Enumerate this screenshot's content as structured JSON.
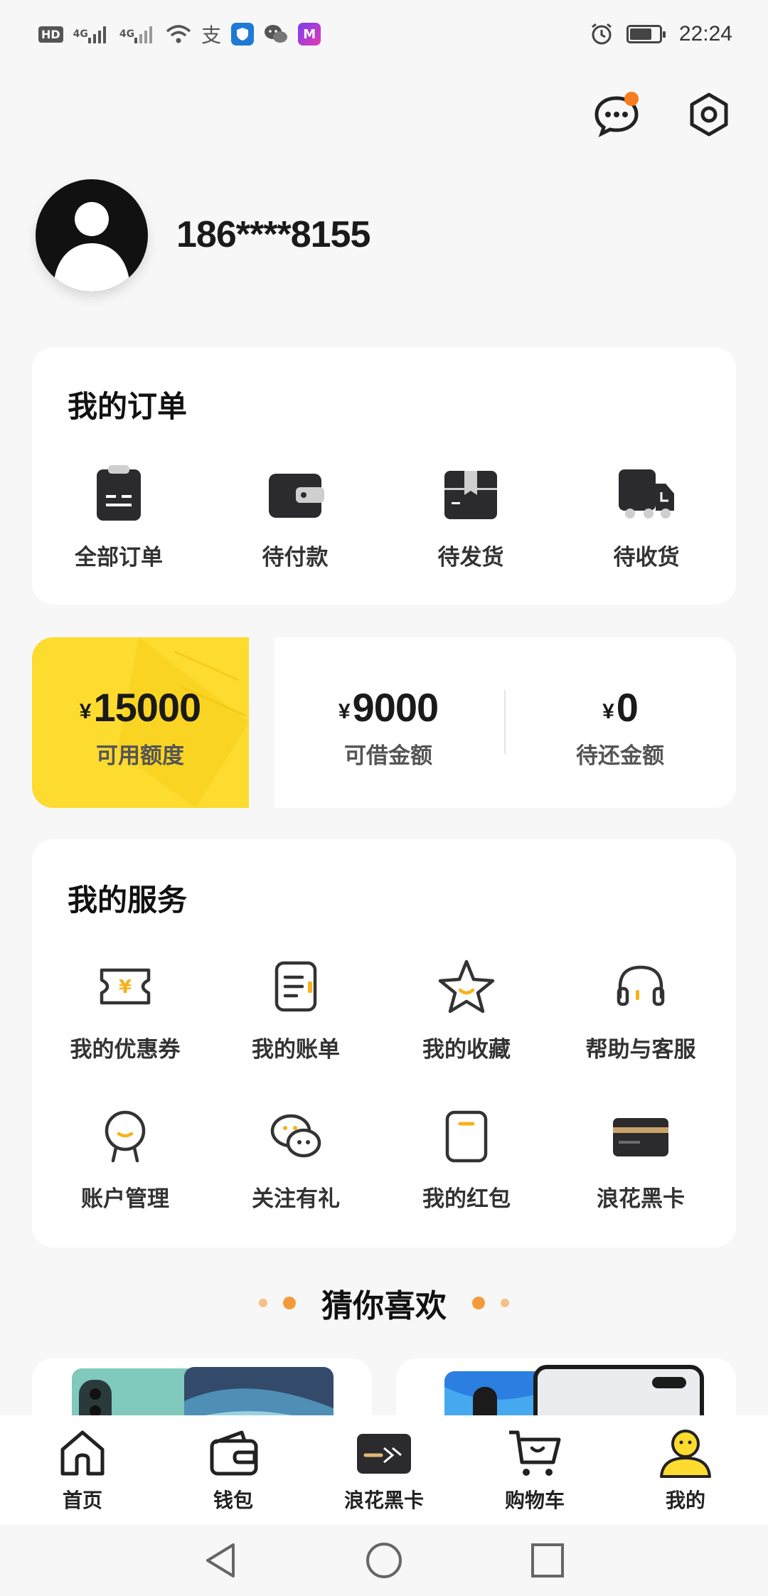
{
  "status_bar": {
    "hd_label": "HD",
    "net1": "4G",
    "net2": "4G",
    "alipay_glyph": "支",
    "time": "22:24"
  },
  "profile": {
    "phone": "186****8155"
  },
  "orders": {
    "title": "我的订单",
    "items": [
      {
        "label": "全部订单",
        "icon": "clipboard-icon"
      },
      {
        "label": "待付款",
        "icon": "wallet-icon"
      },
      {
        "label": "待发货",
        "icon": "box-icon"
      },
      {
        "label": "待收货",
        "icon": "truck-icon"
      }
    ]
  },
  "credit": {
    "currency": "¥",
    "available": {
      "value": "15000",
      "label": "可用额度"
    },
    "borrowable": {
      "value": "9000",
      "label": "可借金额"
    },
    "repay": {
      "value": "0",
      "label": "待还金额"
    }
  },
  "services": {
    "title": "我的服务",
    "items": [
      {
        "label": "我的优惠券",
        "icon": "coupon-icon"
      },
      {
        "label": "我的账单",
        "icon": "bill-icon"
      },
      {
        "label": "我的收藏",
        "icon": "star-icon"
      },
      {
        "label": "帮助与客服",
        "icon": "headset-icon"
      },
      {
        "label": "账户管理",
        "icon": "account-icon"
      },
      {
        "label": "关注有礼",
        "icon": "chat-bubbles-icon"
      },
      {
        "label": "我的红包",
        "icon": "red-packet-icon"
      },
      {
        "label": "浪花黑卡",
        "icon": "black-card-icon"
      }
    ]
  },
  "recommend": {
    "title": "猜你喜欢"
  },
  "tabs": [
    {
      "label": "首页",
      "icon": "home-icon"
    },
    {
      "label": "钱包",
      "icon": "wallet-tab-icon"
    },
    {
      "label": "浪花黑卡",
      "icon": "black-card-tab-icon"
    },
    {
      "label": "购物车",
      "icon": "cart-icon"
    },
    {
      "label": "我的",
      "icon": "profile-tab-icon"
    }
  ],
  "colors": {
    "accent_yellow": "#fddb2f",
    "accent_orange": "#f59a3a",
    "dark_icon": "#2b2b2e"
  }
}
